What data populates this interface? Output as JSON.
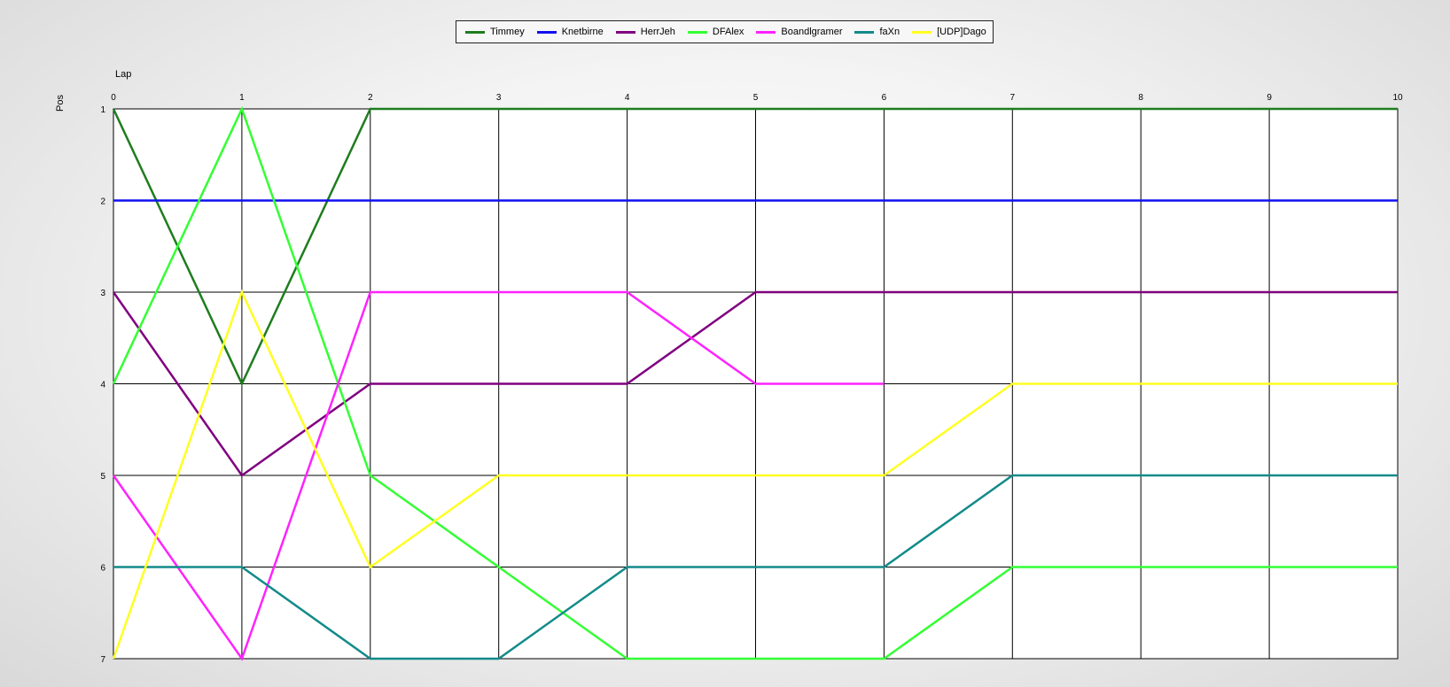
{
  "chart_data": {
    "type": "line",
    "xlabel": "Lap",
    "ylabel": "Pos",
    "xlim": [
      0,
      10
    ],
    "ylim": [
      1,
      7
    ],
    "y_inverted": true,
    "grid": true,
    "legend_position": "top-center",
    "x": [
      0,
      1,
      2,
      3,
      4,
      5,
      6,
      7,
      8,
      9,
      10
    ],
    "x_ticks": [
      "0",
      "1",
      "2",
      "3",
      "4",
      "5",
      "6",
      "7",
      "8",
      "9",
      "10"
    ],
    "y_ticks": [
      "1",
      "2",
      "3",
      "4",
      "5",
      "6",
      "7"
    ],
    "series": [
      {
        "name": "Timmey",
        "color": "#1e7d1e",
        "values": [
          1,
          4,
          1,
          1,
          1,
          1,
          1,
          1,
          1,
          1,
          1
        ]
      },
      {
        "name": "Knetbirne",
        "color": "#1010ee",
        "values": [
          2,
          2,
          2,
          2,
          2,
          2,
          2,
          2,
          2,
          2,
          2
        ]
      },
      {
        "name": "HerrJeh",
        "color": "#800080",
        "values": [
          3,
          5,
          4,
          4,
          4,
          3,
          3,
          3,
          3,
          3,
          3
        ]
      },
      {
        "name": "DFAlex",
        "color": "#33ff33",
        "values": [
          4,
          1,
          5,
          6,
          7,
          7,
          7,
          6,
          6,
          6,
          6
        ]
      },
      {
        "name": "Boandlgramer",
        "color": "#ff22ff",
        "values": [
          5,
          7,
          3,
          3,
          3,
          4,
          4,
          null,
          null,
          null,
          null
        ]
      },
      {
        "name": "faXn",
        "color": "#138a8a",
        "values": [
          6,
          6,
          7,
          7,
          6,
          6,
          6,
          5,
          5,
          5,
          5
        ]
      },
      {
        "name": "[UDP]Dago",
        "color": "#ffff22",
        "values": [
          7,
          3,
          6,
          5,
          5,
          5,
          5,
          4,
          4,
          4,
          4
        ]
      }
    ]
  }
}
